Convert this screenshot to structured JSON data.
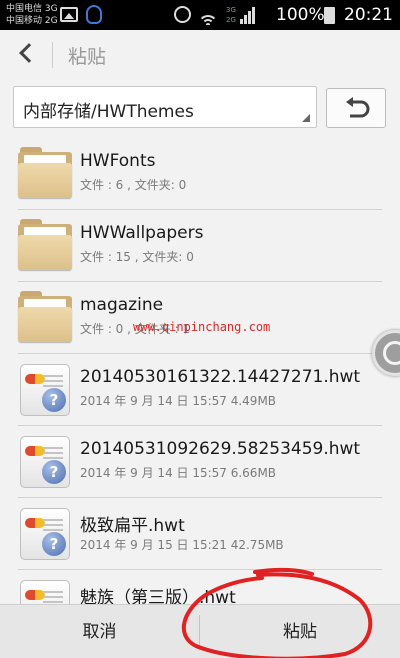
{
  "status_bar": {
    "carrier_1": "中国电信 3G",
    "carrier_2": "中国移动 2G",
    "network_top": "3G",
    "network_bottom": "2G",
    "battery_percent": "100%",
    "time": "20:21",
    "icons": [
      "picture-icon",
      "qq-icon",
      "alarm-icon",
      "wifi-icon",
      "signal-icon",
      "battery-icon"
    ]
  },
  "title_bar": {
    "title": "粘贴",
    "back_icon": "back-arrow-icon"
  },
  "path_bar": {
    "path": "内部存储/HWThemes",
    "up_icon": "return-arrow-icon"
  },
  "files": [
    {
      "name": "HWFonts",
      "meta": "文件 : 6 , 文件夹: 0",
      "icon": "folder-icon"
    },
    {
      "name": "HWWallpapers",
      "meta": "文件 : 15 , 文件夹: 0",
      "icon": "folder-icon"
    },
    {
      "name": "magazine",
      "meta": "文件 : 0 , 文件夹 : 1",
      "icon": "folder-icon"
    },
    {
      "name": "20140530161322.14427271.hwt",
      "meta": "2014 年 9 月 14 日 15:57  4.49MB",
      "icon": "theme-file-icon"
    },
    {
      "name": "20140531092629.58253459.hwt",
      "meta": "2014 年 9 月 14 日 15:57  6.66MB",
      "icon": "theme-file-icon"
    },
    {
      "name": "极致扁平.hwt",
      "meta": "2014 年 9 月 15 日 15:21  42.75MB",
      "icon": "theme-file-icon"
    },
    {
      "name": "魅族（第三版）.hwt",
      "meta": "",
      "icon": "theme-file-icon"
    }
  ],
  "watermark": "www.qinpinchang.com",
  "bottom_bar": {
    "cancel_label": "取消",
    "paste_label": "粘贴"
  },
  "colors": {
    "annotation_circle": "#e02222",
    "folder": "#e8cf9c",
    "help_badge": "#4d6fb2"
  }
}
